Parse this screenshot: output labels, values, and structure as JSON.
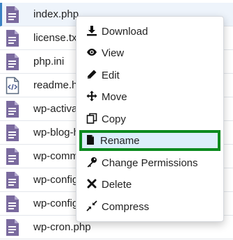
{
  "files": [
    {
      "name": "index.php",
      "type": "doc"
    },
    {
      "name": "license.txt",
      "type": "doc"
    },
    {
      "name": "php.ini",
      "type": "doc"
    },
    {
      "name": "readme.html",
      "type": "code"
    },
    {
      "name": "wp-activate.php",
      "type": "doc"
    },
    {
      "name": "wp-blog-header.php",
      "type": "doc"
    },
    {
      "name": "wp-comments-post.php",
      "type": "doc"
    },
    {
      "name": "wp-config.php",
      "type": "doc"
    },
    {
      "name": "wp-config-sample.php",
      "type": "doc"
    },
    {
      "name": "wp-cron.php",
      "type": "doc"
    }
  ],
  "context_menu": {
    "items": [
      {
        "label": "Download",
        "icon": "download-icon"
      },
      {
        "label": "View",
        "icon": "eye-icon"
      },
      {
        "label": "Edit",
        "icon": "pencil-icon"
      },
      {
        "label": "Move",
        "icon": "move-arrows-icon"
      },
      {
        "label": "Copy",
        "icon": "copy-icon"
      },
      {
        "label": "Rename",
        "icon": "file-icon"
      },
      {
        "label": "Change Permissions",
        "icon": "key-icon"
      },
      {
        "label": "Delete",
        "icon": "x-icon"
      },
      {
        "label": "Compress",
        "icon": "compress-icon"
      }
    ],
    "highlighted": "Rename"
  },
  "colors": {
    "file_icon": "#7a6a9e",
    "highlight_border": "#0b8a1f",
    "highlight_bg": "#dceefb"
  }
}
